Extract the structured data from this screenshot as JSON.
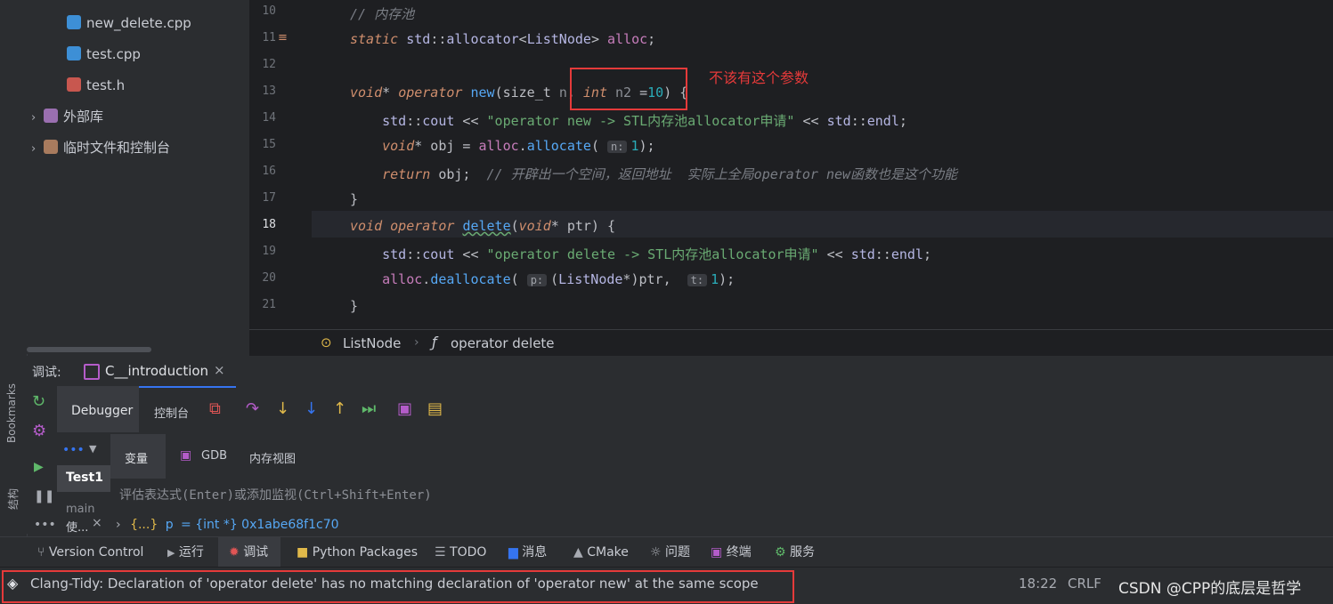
{
  "project_tree": {
    "items": [
      {
        "label": "new_delete.cpp",
        "icon": "cpp-file-icon"
      },
      {
        "label": "test.cpp",
        "icon": "cpp-file-icon"
      },
      {
        "label": "test.h",
        "icon": "header-file-icon"
      },
      {
        "label": "外部库",
        "icon": "library-icon"
      },
      {
        "label": "临时文件和控制台",
        "icon": "scratch-icon"
      }
    ]
  },
  "editor": {
    "line_numbers": [
      "10",
      "11",
      "12",
      "13",
      "14",
      "15",
      "16",
      "17",
      "18",
      "19",
      "20",
      "21"
    ],
    "current_line": "18",
    "annotation": "不该有这个参数",
    "hints": {
      "n": "n:",
      "p": "p:",
      "t": "t:"
    },
    "breadcrumb": {
      "class": "ListNode",
      "method": "operator delete"
    }
  },
  "debug": {
    "label": "调试:",
    "config_tab": "C__introduction",
    "tabs": [
      "Debugger",
      "控制台"
    ],
    "sub_tabs": [
      "变量",
      "GDB",
      "内存视图"
    ],
    "frames": [
      "Test1",
      "main"
    ],
    "eval_placeholder": "评估表达式(Enter)或添加监视(Ctrl+Shift+Enter)",
    "variable": {
      "name": "p",
      "value": "= {int *} 0x1abe68f1c70",
      "badge": "{...}"
    },
    "threads_label": "使..."
  },
  "side_labels": {
    "bookmarks": "Bookmarks",
    "structure": "结构"
  },
  "bottom_bar": [
    "Version Control",
    "运行",
    "调试",
    "Python Packages",
    "TODO",
    "消息",
    "CMake",
    "问题",
    "终端",
    "服务"
  ],
  "status": {
    "message": "Clang-Tidy: Declaration of 'operator delete' has no matching declaration of 'operator new' at the same scope",
    "position": "18:22",
    "line_sep": "CRLF",
    "watermark": "CSDN @CPP的底层是哲学"
  },
  "colors": {
    "accent": "#3574f0",
    "annotation_red": "#e53a3a"
  }
}
